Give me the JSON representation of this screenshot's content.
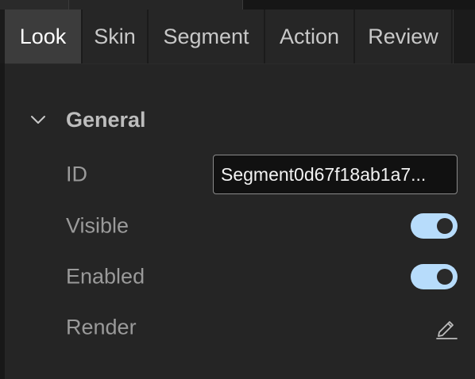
{
  "tabs": [
    {
      "label": "Look",
      "active": true
    },
    {
      "label": "Skin",
      "active": false
    },
    {
      "label": "Segment",
      "active": false
    },
    {
      "label": "Action",
      "active": false
    },
    {
      "label": "Review",
      "active": false
    }
  ],
  "section": {
    "title": "General",
    "expanded": true,
    "icon": "chevron-down-icon"
  },
  "properties": {
    "id": {
      "label": "ID",
      "value": "Segment0d67f18ab1a7..."
    },
    "visible": {
      "label": "Visible",
      "on": true
    },
    "enabled": {
      "label": "Enabled",
      "on": true
    },
    "render": {
      "label": "Render",
      "icon": "pencil-edit-icon"
    }
  },
  "colors": {
    "background": "#252525",
    "toggle_on": "#b7dcfb",
    "active_tab": "#3c3c3c"
  }
}
